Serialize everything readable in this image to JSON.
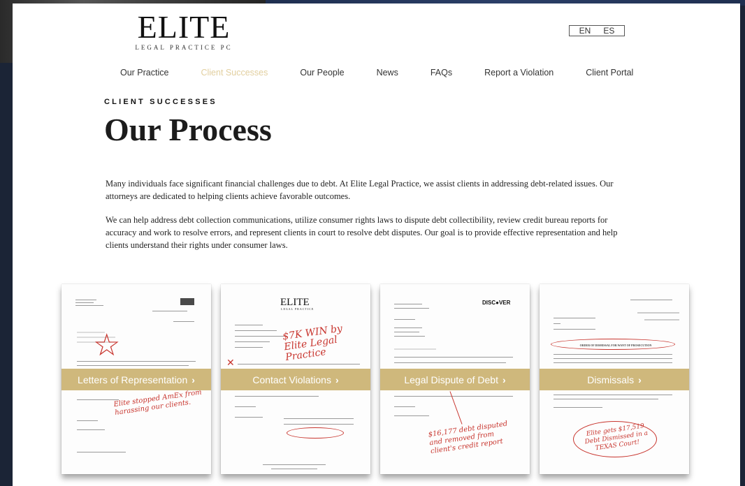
{
  "brand": {
    "logo_main": "ELITE",
    "logo_sub": "LEGAL PRACTICE PC"
  },
  "language": {
    "en": "EN",
    "es": "ES"
  },
  "nav": {
    "items": [
      "Our Practice",
      "Client Successes",
      "Our People",
      "News",
      "FAQs",
      "Report a Violation",
      "Client Portal"
    ],
    "active_index": 1
  },
  "section": {
    "eyebrow": "CLIENT SUCCESSES",
    "title": "Our Process",
    "paragraph1": "Many individuals face significant financial challenges due to debt. At Elite Legal Practice, we assist clients in addressing debt-related issues. Our attorneys are dedicated to helping clients achieve favorable outcomes.",
    "paragraph2": "We can help address debt collection communications, utilize consumer rights laws to dispute debt collectibility, review credit bureau reports for accuracy and work to resolve errors, and represent clients in court to resolve debt disputes. Our goal is to provide effective representation and help clients understand their rights under consumer laws."
  },
  "cards": [
    {
      "label": "Letters of Representation",
      "arrow": "›",
      "note": "Elite stopped AmEx from harassing our clients."
    },
    {
      "label": "Contact Violations",
      "arrow": "›",
      "doc_logo": "ELITE",
      "doc_logo_sub": "LEGAL PRACTICE",
      "note": "$7K WIN by Elite Legal Practice"
    },
    {
      "label": "Legal Dispute of Debt",
      "arrow": "›",
      "doc_logo": "DISC●VER",
      "note": "$16,177 debt disputed and removed from client's credit report"
    },
    {
      "label": "Dismissals",
      "arrow": "›",
      "doc_heading": "ORDER OF DISMISSAL FOR WANT OF PROSECUTION",
      "note": "Elite gets $17,519 Debt Dismissed in a TEXAS Court!"
    }
  ],
  "colors": {
    "accent_gold": "#cfb87c",
    "nav_active": "#e2cf9f",
    "annotation_red": "#c8352e",
    "background_navy": "#1b2436"
  }
}
